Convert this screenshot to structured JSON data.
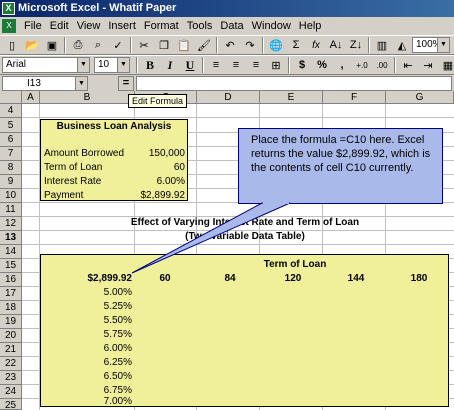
{
  "window": {
    "title": "Microsoft Excel - Whatif Paper",
    "app_icon": "excel-icon"
  },
  "menu": [
    "File",
    "Edit",
    "View",
    "Insert",
    "Format",
    "Tools",
    "Data",
    "Window",
    "Help"
  ],
  "toolbar": {
    "zoom": "100%",
    "font_name": "Arial",
    "font_size": "10",
    "bold": "B",
    "italic": "I",
    "underline": "U",
    "currency": "$",
    "percent": "%",
    "comma": ",",
    "sigma": "Σ",
    "fx": "fx"
  },
  "formula_bar": {
    "name_box": "I13",
    "equals": "=",
    "tooltip": "Edit Formula"
  },
  "columns": [
    "A",
    "B",
    "C",
    "D",
    "E",
    "F",
    "G"
  ],
  "rows": [
    "4",
    "5",
    "6",
    "7",
    "8",
    "9",
    "10",
    "11",
    "12",
    "13",
    "14",
    "15",
    "16",
    "17",
    "18",
    "19",
    "20",
    "21",
    "22",
    "23",
    "24",
    "25"
  ],
  "active_row": "13",
  "loan_analysis": {
    "title": "Business Loan Analysis",
    "amount_label": "Amount Borrowed",
    "amount_value": "150,000",
    "term_label": "Term of Loan",
    "term_value": "60",
    "rate_label": "Interest Rate",
    "rate_value": "6.00%",
    "payment_label": "Payment",
    "payment_value": "$2,899.92"
  },
  "data_table": {
    "heading": "Effect of Varying Interest Rate and Term of Loan",
    "subheading": "(Two Variable Data Table)",
    "term_header": "Term of Loan",
    "corner_value": "$2,899.92",
    "terms": [
      "60",
      "84",
      "120",
      "144",
      "180"
    ],
    "rates": [
      "5.00%",
      "5.25%",
      "5.50%",
      "5.75%",
      "6.00%",
      "6.25%",
      "6.50%",
      "6.75%",
      "7.00%"
    ]
  },
  "callout": {
    "text": "Place the formula =C10 here. Excel returns the value $2,899.92, which is the contents of cell C10 currently."
  },
  "colors": {
    "title_bar": "#0a246a",
    "highlight_fill": "#f0f09a",
    "callout_fill": "#a9b9ea"
  }
}
